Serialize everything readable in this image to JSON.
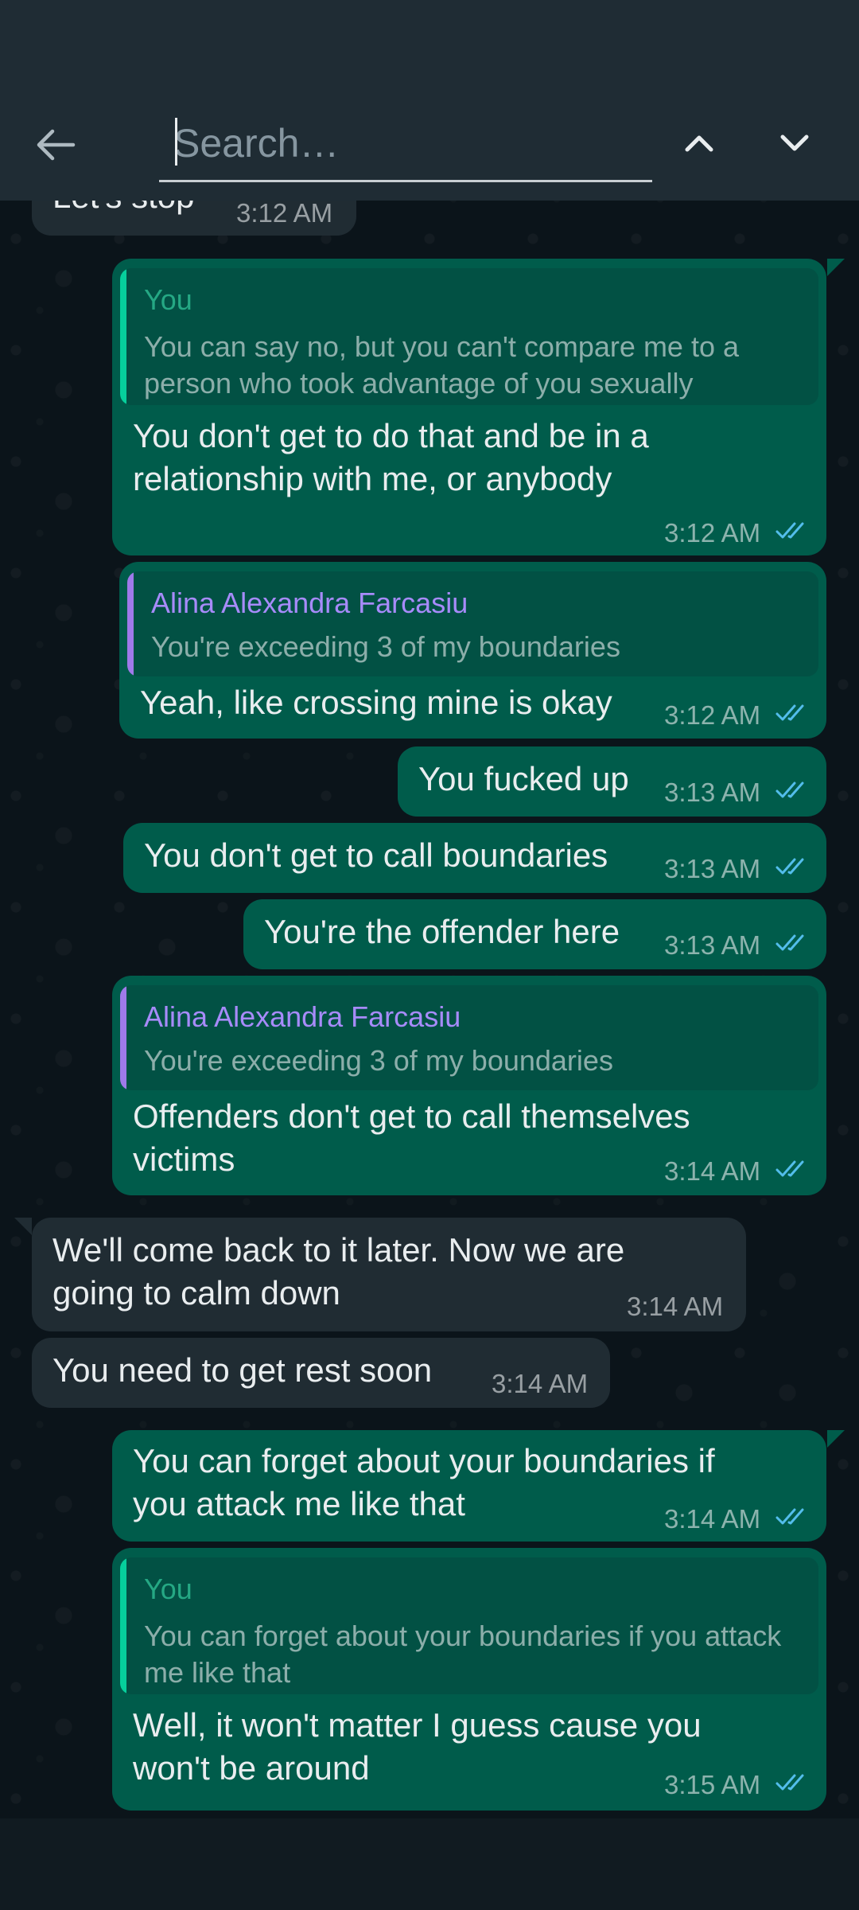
{
  "search": {
    "placeholder": "Search…",
    "value": ""
  },
  "colors": {
    "tick": "#53bdeb",
    "you_name": "#25a884",
    "contact_name": "#a78bfa",
    "quote_bar_you": "#06cf9c",
    "quote_bar_contact": "#9f7aea"
  },
  "messages": [
    {
      "text": "Let's stop",
      "time": "3:12 AM"
    },
    {
      "quote_name": "You",
      "quote_text": "You can say no, but you can't compare me to a\nperson who took advantage of you sexually",
      "text": "You don't get to do that and be in a\nrelationship with me, or anybody",
      "time": "3:12 AM"
    },
    {
      "quote_name": "Alina Alexandra Farcasiu",
      "quote_text": "You're exceeding 3 of my boundaries",
      "text": "Yeah, like crossing mine is okay",
      "time": "3:12 AM"
    },
    {
      "text": "You fucked up",
      "time": "3:13 AM"
    },
    {
      "text": "You don't get to call boundaries",
      "time": "3:13 AM"
    },
    {
      "text": "You're the offender here",
      "time": "3:13 AM"
    },
    {
      "quote_name": "Alina Alexandra Farcasiu",
      "quote_text": "You're exceeding 3 of my boundaries",
      "text": "Offenders don't get to call themselves\nvictims",
      "time": "3:14 AM"
    },
    {
      "text": "We'll come back to it later. Now we are\ngoing to calm down",
      "time": "3:14 AM"
    },
    {
      "text": "You need to get rest soon",
      "time": "3:14 AM"
    },
    {
      "text": "You can forget about your boundaries if\nyou attack me like that",
      "time": "3:14 AM"
    },
    {
      "quote_name": "You",
      "quote_text": "You can forget about your boundaries if you\nattack me like that",
      "text": "Well, it won't matter I guess cause you\nwon't be around",
      "time": "3:15 AM"
    }
  ]
}
